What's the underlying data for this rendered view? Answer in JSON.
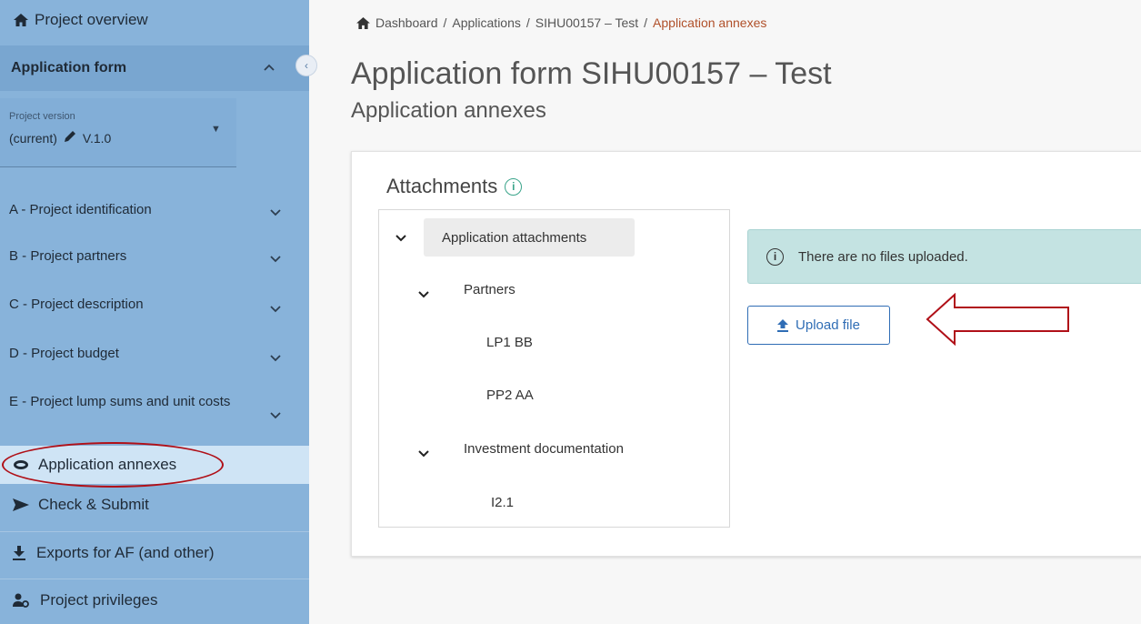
{
  "sidebar": {
    "project_overview": "Project overview",
    "application_form": "Application form",
    "version": {
      "label": "Project version",
      "value": "(current)",
      "version": "V.1.0"
    },
    "sections": [
      {
        "label": "A - Project identification"
      },
      {
        "label": "B - Project partners"
      },
      {
        "label": "C - Project description"
      },
      {
        "label": "D - Project budget"
      },
      {
        "label": "E - Project lump sums and unit costs"
      }
    ],
    "active_item": "Application annexes",
    "check_submit": "Check & Submit",
    "exports": "Exports for AF (and other)",
    "privileges": "Project privileges"
  },
  "breadcrumb": {
    "home": "Dashboard",
    "sep": "/",
    "applications": "Applications",
    "project": "SIHU00157 – Test",
    "current": "Application annexes"
  },
  "header": {
    "title": "Application form SIHU00157 – Test",
    "subtitle": "Application annexes"
  },
  "attachments": {
    "title": "Attachments",
    "tree": {
      "root": "Application attachments",
      "partners": "Partners",
      "partner_items": [
        "LP1 BB",
        "PP2 AA"
      ],
      "investment": "Investment documentation",
      "investment_items": [
        "I2.1"
      ]
    },
    "notice": "There are no files uploaded.",
    "upload_button": "Upload file"
  },
  "colors": {
    "sidebar_bg": "#88b3da",
    "active_bg": "#cfe4f5",
    "accent": "#2f6db5",
    "annotation_red": "#b01018",
    "notice_bg": "#c4e3e2"
  }
}
